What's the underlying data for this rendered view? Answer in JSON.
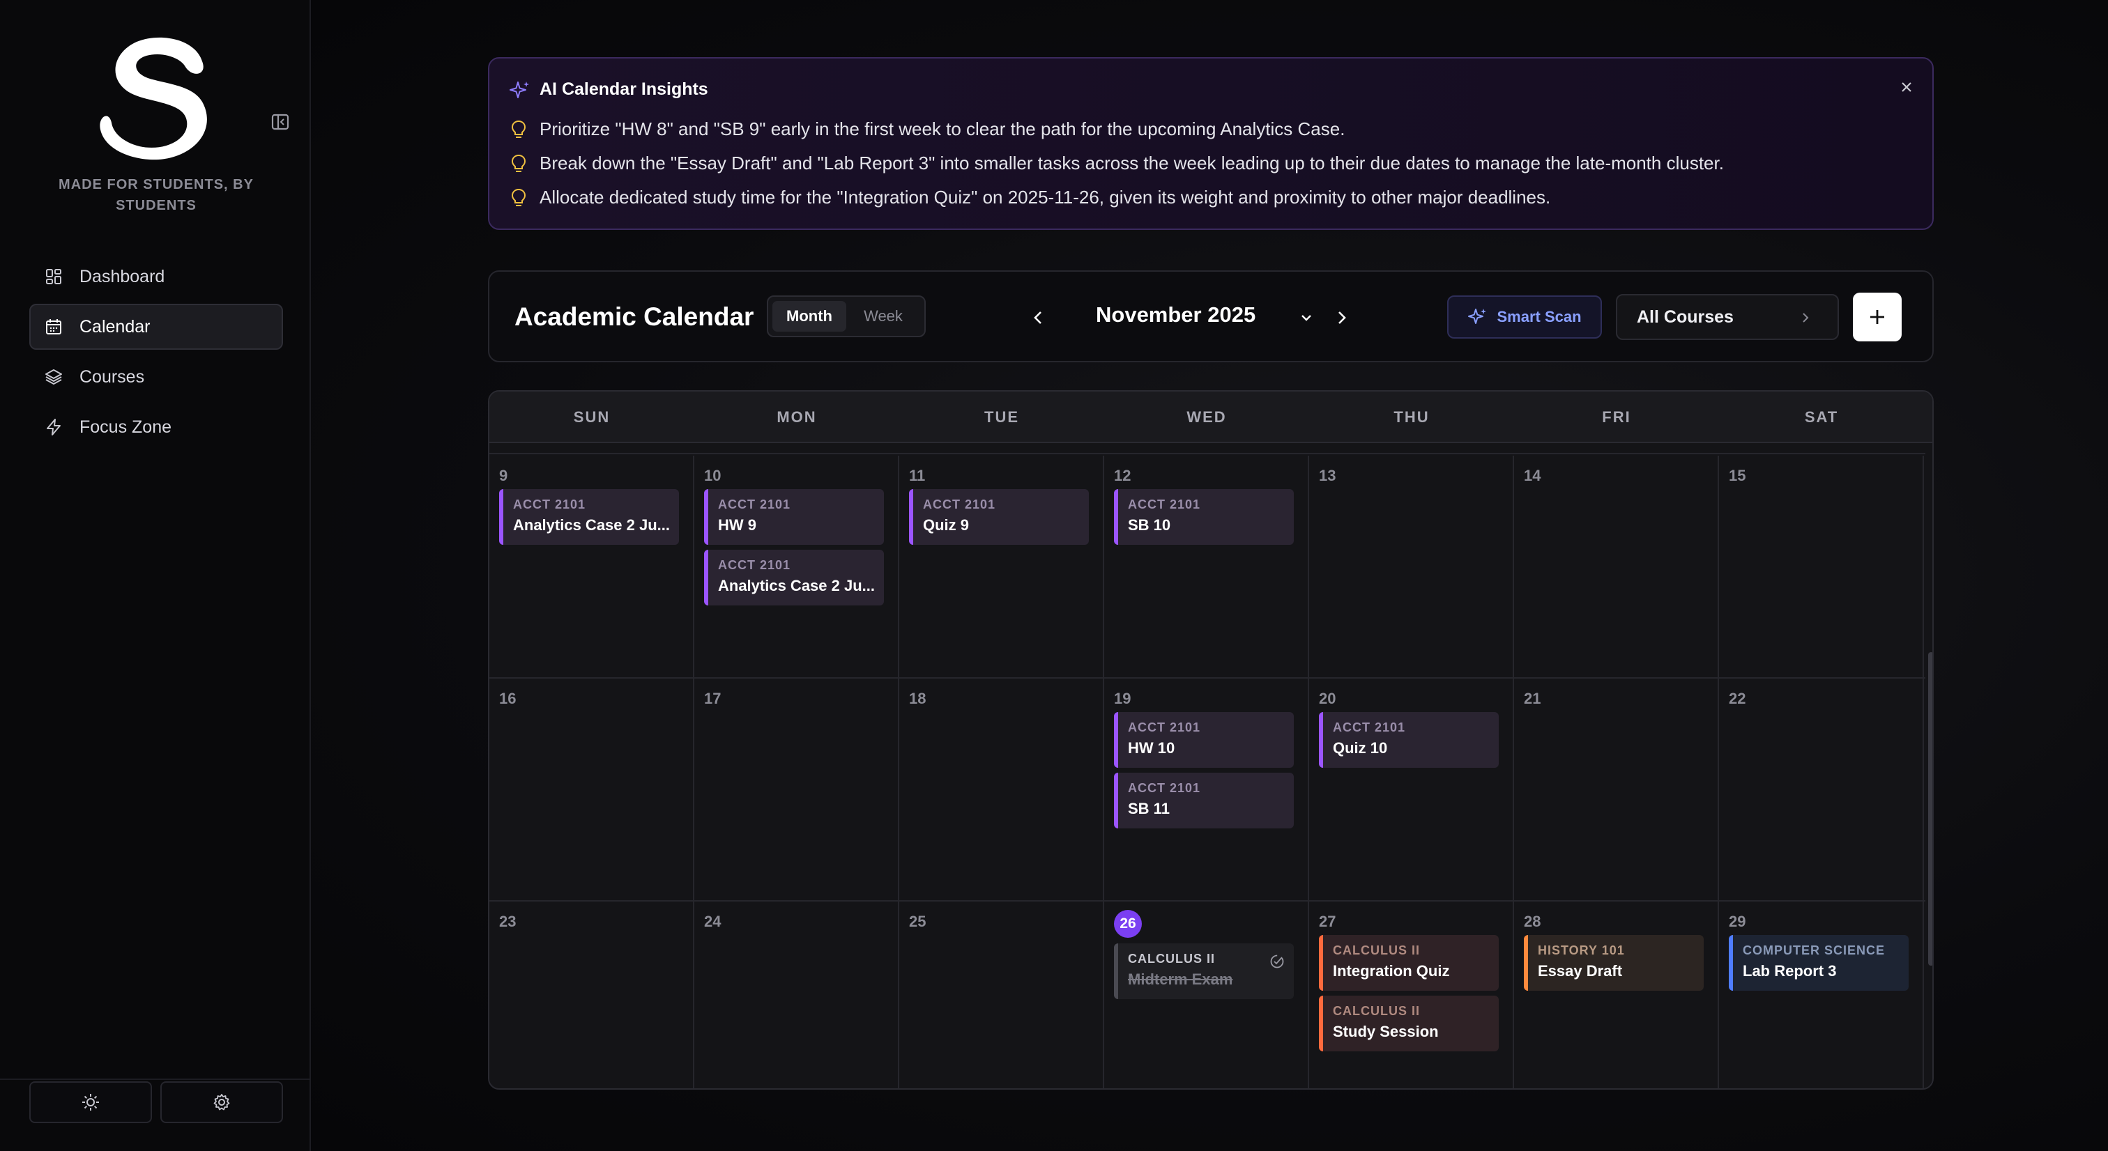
{
  "sidebar": {
    "tagline": "MADE FOR STUDENTS, BY STUDENTS",
    "nav": [
      {
        "label": "Dashboard",
        "icon": "dashboard-icon"
      },
      {
        "label": "Calendar",
        "icon": "calendar-icon",
        "active": true
      },
      {
        "label": "Courses",
        "icon": "layers-icon"
      },
      {
        "label": "Focus Zone",
        "icon": "lightning-icon"
      }
    ],
    "footer": {
      "theme_icon": "sun-icon",
      "settings_icon": "gear-icon"
    }
  },
  "insights": {
    "title": "AI Calendar Insights",
    "tips": [
      "Prioritize \"HW 8\" and \"SB 9\" early in the first week to clear the path for the upcoming Analytics Case.",
      "Break down the \"Essay Draft\" and \"Lab Report 3\" into smaller tasks across the week leading up to their due dates to manage the late-month cluster.",
      "Allocate dedicated study time for the \"Integration Quiz\" on 2025-11-26, given its weight and proximity to other major deadlines."
    ]
  },
  "toolbar": {
    "title": "Academic Calendar",
    "view_month": "Month",
    "view_week": "Week",
    "month_label": "November 2025",
    "smart_scan": "Smart Scan",
    "course_filter": "All Courses"
  },
  "calendar": {
    "days_of_week": [
      "SUN",
      "MON",
      "TUE",
      "WED",
      "THU",
      "FRI",
      "SAT"
    ],
    "weeks": [
      {
        "days": [
          {
            "num": "9",
            "events": [
              {
                "course": "ACCT 2101",
                "title": "Analytics Case 2 Ju..."
              }
            ]
          },
          {
            "num": "10",
            "events": [
              {
                "course": "ACCT 2101",
                "title": "HW 9"
              },
              {
                "course": "ACCT 2101",
                "title": "Analytics Case 2 Ju..."
              }
            ]
          },
          {
            "num": "11",
            "events": [
              {
                "course": "ACCT 2101",
                "title": "Quiz 9"
              }
            ]
          },
          {
            "num": "12",
            "events": [
              {
                "course": "ACCT 2101",
                "title": "SB 10"
              }
            ]
          },
          {
            "num": "13",
            "events": []
          },
          {
            "num": "14",
            "events": []
          },
          {
            "num": "15",
            "events": []
          }
        ]
      },
      {
        "days": [
          {
            "num": "16",
            "events": []
          },
          {
            "num": "17",
            "events": []
          },
          {
            "num": "18",
            "events": []
          },
          {
            "num": "19",
            "events": [
              {
                "course": "ACCT 2101",
                "title": "HW 10"
              },
              {
                "course": "ACCT 2101",
                "title": "SB 11"
              }
            ]
          },
          {
            "num": "20",
            "events": [
              {
                "course": "ACCT 2101",
                "title": "Quiz 10"
              }
            ]
          },
          {
            "num": "21",
            "events": []
          },
          {
            "num": "22",
            "events": []
          }
        ]
      },
      {
        "days": [
          {
            "num": "23",
            "events": []
          },
          {
            "num": "24",
            "events": []
          },
          {
            "num": "25",
            "events": []
          },
          {
            "num": "26",
            "today": true,
            "events": [
              {
                "course": "CALCULUS II",
                "title": "Midterm Exam",
                "completed": true
              }
            ]
          },
          {
            "num": "27",
            "events": [
              {
                "course": "CALCULUS II",
                "title": "Integration Quiz",
                "color": "orange"
              },
              {
                "course": "CALCULUS II",
                "title": "Study Session",
                "color": "orange"
              }
            ]
          },
          {
            "num": "28",
            "events": [
              {
                "course": "HISTORY 101",
                "title": "Essay Draft",
                "color": "amber"
              }
            ]
          },
          {
            "num": "29",
            "events": [
              {
                "course": "COMPUTER SCIENCE",
                "title": "Lab Report 3",
                "color": "blue"
              }
            ]
          }
        ]
      }
    ]
  },
  "colors": {
    "accent": "#7b3ff2",
    "acct": "#9b55ff",
    "calculus": "#ff6a3d",
    "history": "#ff8a3d",
    "cs": "#4f7dff"
  }
}
